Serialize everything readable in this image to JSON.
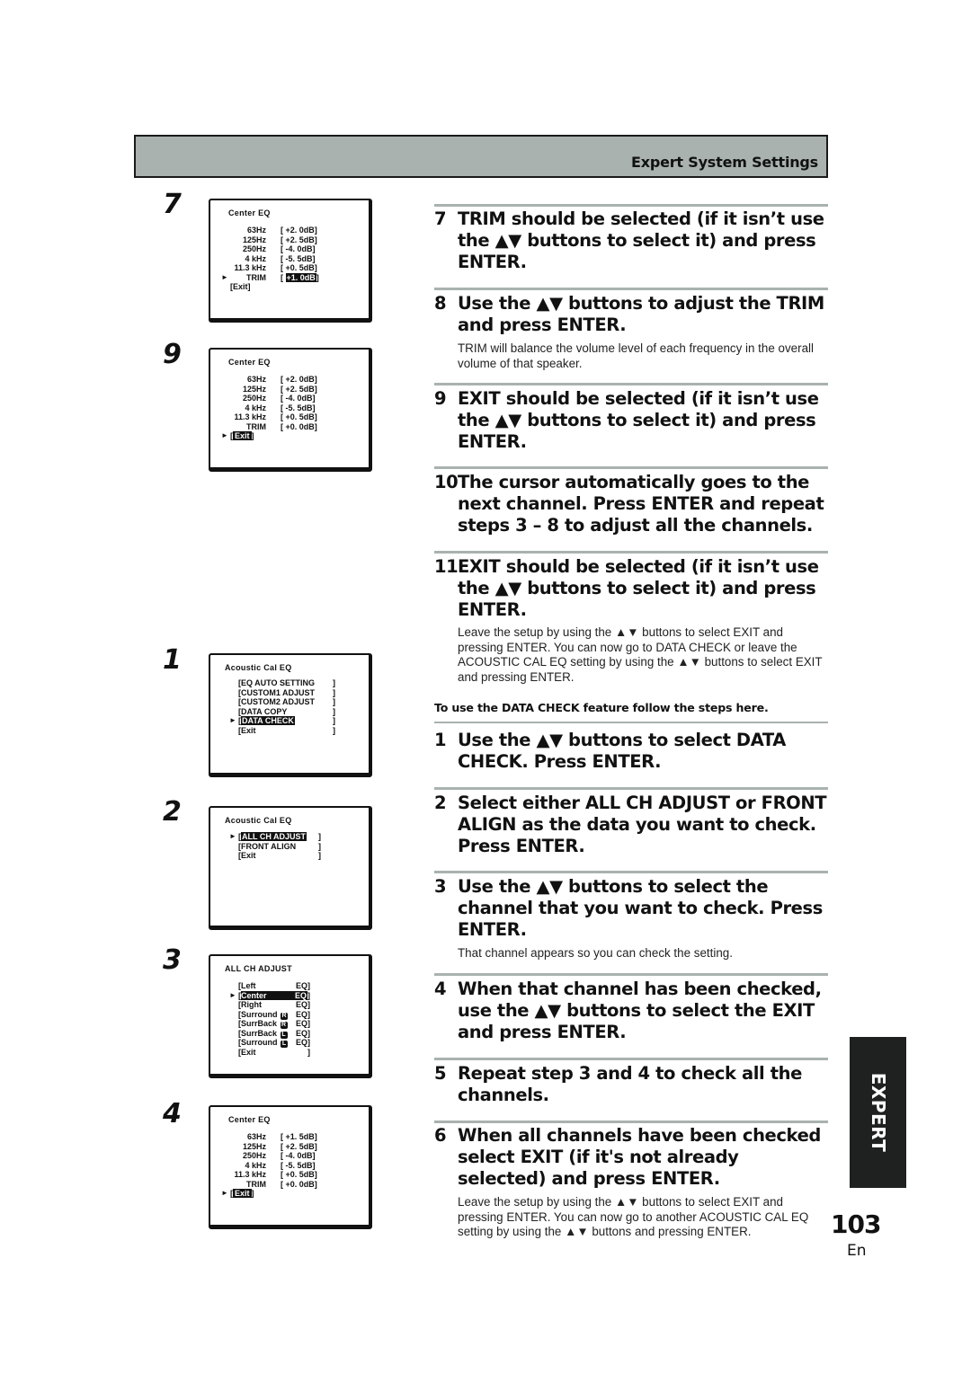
{
  "header": {
    "title": "Expert System Settings",
    "band_color": "#a9b2ae"
  },
  "figures": [
    {
      "number": "7",
      "screen_type": "eq",
      "title": "Center EQ",
      "rows": [
        {
          "label": "63Hz",
          "value": "[ +2. 0dB]"
        },
        {
          "label": "125Hz",
          "value": "[ +2. 5dB]"
        },
        {
          "label": "250Hz",
          "value": "[  -4. 0dB]"
        },
        {
          "label": "4 kHz",
          "value": "[  -5. 5dB]"
        },
        {
          "label": "11.3 kHz",
          "value": "[ +0. 5dB]"
        },
        {
          "label": "TRIM",
          "value_prefix": "[ ",
          "value_hl": "+1. 0dB",
          "value_suffix": "]"
        }
      ],
      "exit_label": "[Exit]",
      "cursor": "TRIM"
    },
    {
      "number": "9",
      "screen_type": "eq",
      "title": "Center EQ",
      "rows": [
        {
          "label": "63Hz",
          "value": "[ +2. 0dB]"
        },
        {
          "label": "125Hz",
          "value": "[ +2. 5dB]"
        },
        {
          "label": "250Hz",
          "value": "[  -4. 0dB]"
        },
        {
          "label": "4 kHz",
          "value": "[  -5. 5dB]"
        },
        {
          "label": "11.3 kHz",
          "value": "[ +0. 5dB]"
        },
        {
          "label": "TRIM",
          "value": "[ +0. 0dB]"
        }
      ],
      "exit_label": "Exit",
      "cursor": "Exit"
    },
    {
      "number": "1",
      "screen_type": "menu",
      "title": "Acoustic  Cal  EQ",
      "items": [
        "EQ AUTO SETTING",
        "CUSTOM1 ADJUST",
        "CUSTOM2 ADJUST",
        "DATA COPY",
        "DATA CHECK",
        "Exit"
      ],
      "cursor": "DATA CHECK"
    },
    {
      "number": "2",
      "screen_type": "menu",
      "title": "Acoustic  Cal  EQ",
      "items": [
        "ALL CH ADJUST",
        "FRONT ALIGN",
        "Exit"
      ],
      "cursor": "ALL CH ADJUST"
    },
    {
      "number": "3",
      "screen_type": "channels",
      "title": "ALL  CH  ADJUST",
      "items": [
        {
          "name": "Left",
          "badge": "",
          "suffix": "EQ"
        },
        {
          "name": "Center",
          "badge": "",
          "suffix": "EQ"
        },
        {
          "name": "Right",
          "badge": "",
          "suffix": "EQ"
        },
        {
          "name": "Surround",
          "badge": "R",
          "suffix": "EQ"
        },
        {
          "name": "SurrBack",
          "badge": "R",
          "suffix": "EQ"
        },
        {
          "name": "SurrBack",
          "badge": "L",
          "suffix": "EQ"
        },
        {
          "name": "Surround",
          "badge": "L",
          "suffix": "EQ"
        },
        {
          "name": "Exit",
          "badge": "",
          "suffix": ""
        }
      ],
      "cursor": "Center"
    },
    {
      "number": "4",
      "screen_type": "eq",
      "title": "Center EQ",
      "rows": [
        {
          "label": "63Hz",
          "value": "[ +1. 5dB]"
        },
        {
          "label": "125Hz",
          "value": "[ +2. 5dB]"
        },
        {
          "label": "250Hz",
          "value": "[  -4. 0dB]"
        },
        {
          "label": "4 kHz",
          "value": "[  -5. 5dB]"
        },
        {
          "label": "11.3 kHz",
          "value": "[ +0. 5dB]"
        },
        {
          "label": "TRIM",
          "value": "[ +0. 0dB]"
        }
      ],
      "exit_label": "Exit",
      "cursor": "Exit"
    }
  ],
  "steps_a": [
    {
      "num": "7",
      "text": "TRIM should be selected (if it isn’t use the ▲▼ buttons to select it) and press ENTER."
    },
    {
      "num": "8",
      "text": "Use the ▲▼ buttons to adjust the TRIM and press ENTER.",
      "note": "TRIM will balance the volume level of each frequency in the overall volume of that speaker."
    },
    {
      "num": "9",
      "text": "EXIT should be selected (if it isn’t use the ▲▼ buttons to select it) and press ENTER."
    },
    {
      "num": "10",
      "text": "The cursor automatically goes to the next channel. Press ENTER and repeat steps 3 – 8 to adjust all the channels."
    },
    {
      "num": "11",
      "text": "EXIT should be selected (if it isn’t use the ▲▼ buttons to select it) and press ENTER.",
      "note": "Leave the setup by using the ▲▼ buttons to select EXIT and pressing ENTER. You can now go to DATA CHECK or leave the ACOUSTIC CAL EQ setting by using the ▲▼ buttons to select EXIT and pressing ENTER."
    }
  ],
  "subhead": "To use the DATA CHECK feature follow the steps here.",
  "steps_b": [
    {
      "num": "1",
      "text": "Use the ▲▼ buttons to select DATA CHECK. Press ENTER."
    },
    {
      "num": "2",
      "text": "Select either ALL CH ADJUST or FRONT ALIGN as the data you want to check. Press ENTER."
    },
    {
      "num": "3",
      "text": "Use the ▲▼ buttons to select the channel that you want to check. Press ENTER.",
      "note": "That channel appears so you can check the setting."
    },
    {
      "num": "4",
      "text": "When that channel has been checked, use the ▲▼ buttons to select the EXIT and press ENTER."
    },
    {
      "num": "5",
      "text": "Repeat step 3 and 4 to check all the channels."
    },
    {
      "num": "6",
      "text": "When all channels have been checked select EXIT (if it's not already selected) and press ENTER.",
      "note": "Leave the setup by using the ▲▼ buttons to select EXIT and pressing ENTER. You can now go to another ACOUSTIC CAL EQ setting by using the ▲▼ buttons and pressing ENTER."
    }
  ],
  "side_tab": {
    "label": "EXPERT"
  },
  "footer": {
    "page_number": "103",
    "language": "En"
  }
}
